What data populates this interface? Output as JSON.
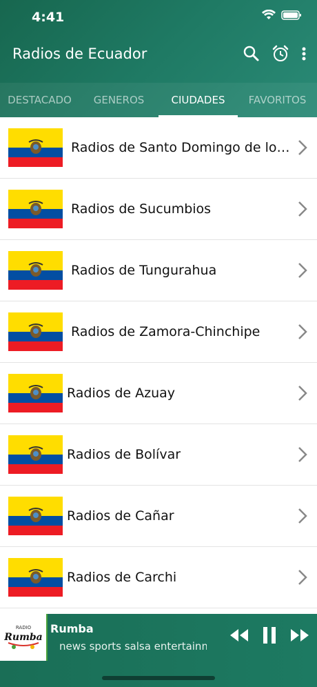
{
  "status": {
    "time": "4:41"
  },
  "app": {
    "title": "Radios de Ecuador"
  },
  "tabs": [
    {
      "label": "DESTACADO"
    },
    {
      "label": "GENEROS"
    },
    {
      "label": "CIUDADES",
      "active": true
    },
    {
      "label": "FAVORITOS"
    }
  ],
  "list": {
    "items": [
      {
        "label": "Radios de Santo Domingo de los T..."
      },
      {
        "label": "Radios de Sucumbios"
      },
      {
        "label": "Radios de Tungurahua"
      },
      {
        "label": "Radios de Zamora-Chinchipe"
      },
      {
        "label": "Radios de Azuay"
      },
      {
        "label": "Radios de Bolívar"
      },
      {
        "label": "Radios de Cañar"
      },
      {
        "label": "Radios de Carchi"
      }
    ]
  },
  "player": {
    "station": "Rumba",
    "tags": "news sports salsa entertainment",
    "logo_text_top": "RADIO",
    "logo_text": "Rumba"
  },
  "colors": {
    "header": "#1f7a64",
    "flag_yellow": "#ffdd00",
    "flag_blue": "#034ea2",
    "flag_red": "#ed1c24"
  }
}
